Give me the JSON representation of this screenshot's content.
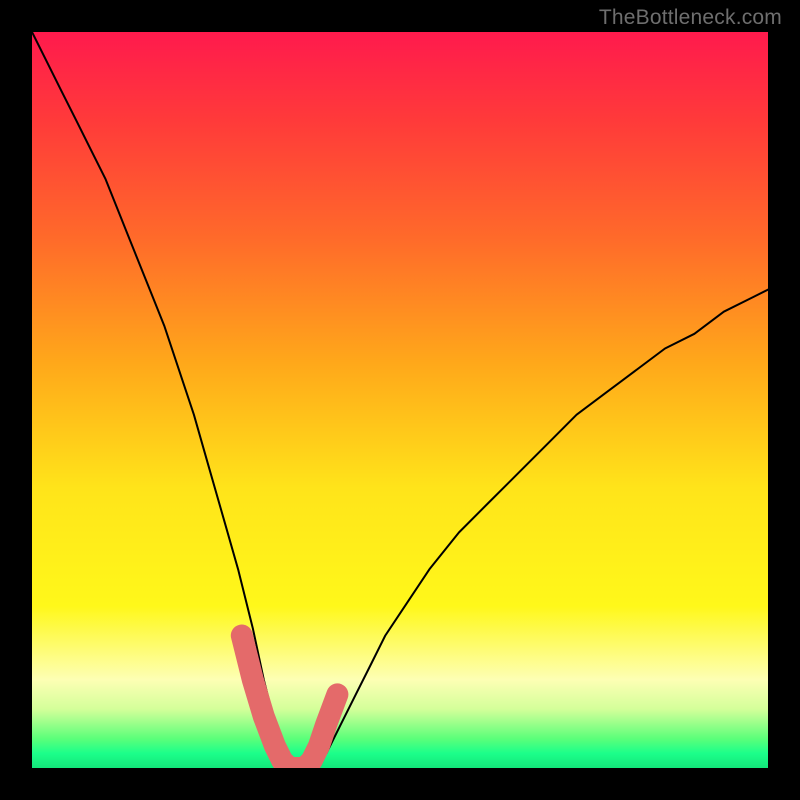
{
  "watermark": "TheBottleneck.com",
  "chart_data": {
    "type": "line",
    "title": "",
    "xlabel": "",
    "ylabel": "",
    "xlim": [
      0,
      100
    ],
    "ylim": [
      0,
      100
    ],
    "series": [
      {
        "name": "bottleneck-curve",
        "x": [
          0,
          2,
          4,
          6,
          8,
          10,
          12,
          14,
          16,
          18,
          20,
          22,
          24,
          26,
          28,
          30,
          31.5,
          33,
          34,
          35,
          36,
          37,
          38,
          40,
          42,
          44,
          46,
          48,
          50,
          54,
          58,
          62,
          66,
          70,
          74,
          78,
          82,
          86,
          90,
          94,
          98,
          100
        ],
        "y": [
          100,
          96,
          92,
          88,
          84,
          80,
          75,
          70,
          65,
          60,
          54,
          48,
          41,
          34,
          27,
          19,
          12,
          6,
          2,
          0,
          0,
          0,
          0,
          2,
          6,
          10,
          14,
          18,
          21,
          27,
          32,
          36,
          40,
          44,
          48,
          51,
          54,
          57,
          59,
          62,
          64,
          65
        ]
      }
    ],
    "highlight_region": {
      "name": "optimal-range",
      "x": [
        28.5,
        30,
        31.5,
        33,
        34,
        35,
        36,
        37,
        38,
        39,
        40,
        41.5
      ],
      "y": [
        18,
        12,
        7,
        3,
        1,
        0,
        0,
        0,
        1,
        3,
        6,
        10
      ]
    },
    "background": {
      "type": "vertical-gradient",
      "stops": [
        {
          "pos": 0.0,
          "meaning": "worst",
          "color": "#ff1a4d"
        },
        {
          "pos": 0.5,
          "meaning": "mid",
          "color": "#ffd21a"
        },
        {
          "pos": 0.9,
          "meaning": "good",
          "color": "#fdffb4"
        },
        {
          "pos": 1.0,
          "meaning": "optimal",
          "color": "#13e67a"
        }
      ]
    }
  }
}
